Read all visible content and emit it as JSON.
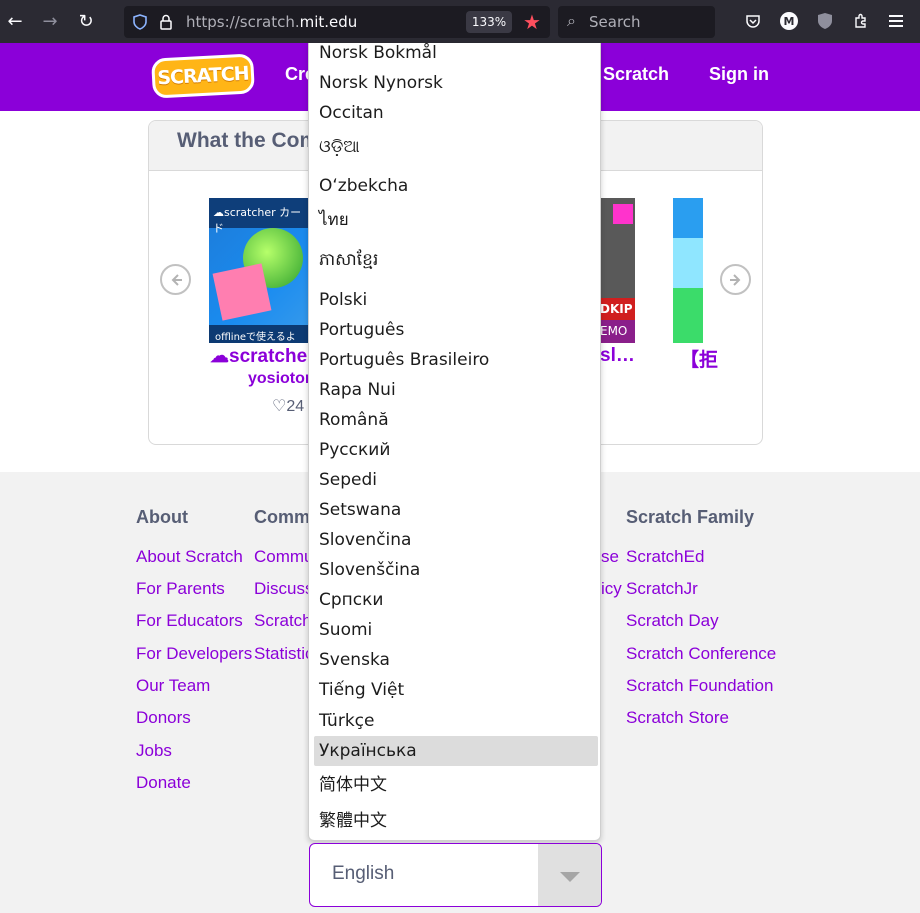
{
  "browser": {
    "url_scheme": "https://scratch.",
    "url_host": "mit.edu",
    "zoom": "133%",
    "search_placeholder": "Search",
    "back_icon": "←",
    "forward_icon": "→",
    "reload_icon": "↻",
    "account_initial": "M"
  },
  "header": {
    "logo_text": "SCRATCH",
    "create": "Create",
    "about_scratch": "Scratch",
    "sign_in": "Sign in"
  },
  "carousel": {
    "title": "What the Community",
    "projects": [
      {
        "title": "☁scratcher",
        "author": "yosiotori",
        "loves": "24",
        "thumb_band": "☁scratcher カード",
        "thumb_foot": "offlineで使えるよ"
      },
      {
        "title": "sl…",
        "thumb_red": "DKIP",
        "thumb_memo": "EMO"
      },
      {
        "title": "【拒"
      }
    ]
  },
  "footer": {
    "about": {
      "heading": "About",
      "links": [
        "About Scratch",
        "For Parents",
        "For Educators",
        "For Developers",
        "Our Team",
        "Donors",
        "Jobs",
        "Donate"
      ]
    },
    "community": {
      "heading": "Community",
      "links": [
        "Community",
        "Discuss",
        "Scratch",
        "Statistics"
      ]
    },
    "legal_partial": [
      "se",
      "icy"
    ],
    "family": {
      "heading": "Scratch Family",
      "links": [
        "ScratchEd",
        "ScratchJr",
        "Scratch Day",
        "Scratch Conference",
        "Scratch Foundation",
        "Scratch Store"
      ]
    }
  },
  "language_dropdown": {
    "options": [
      "Norsk Bokmål",
      "Norsk Nynorsk",
      "Occitan",
      "ଓଡ଼ିଆ",
      "Oʻzbekcha",
      "ไทย",
      "ភាសាខ្មែរ",
      "Polski",
      "Português",
      "Português Brasileiro",
      "Rapa Nui",
      "Română",
      "Русский",
      "Sepedi",
      "Setswana",
      "Slovenčina",
      "Slovenščina",
      "Српски",
      "Suomi",
      "Svenska",
      "Tiếng Việt",
      "Türkçe",
      "Українська",
      "简体中文",
      "繁體中文"
    ],
    "highlighted": "Українська",
    "selected": "English"
  }
}
